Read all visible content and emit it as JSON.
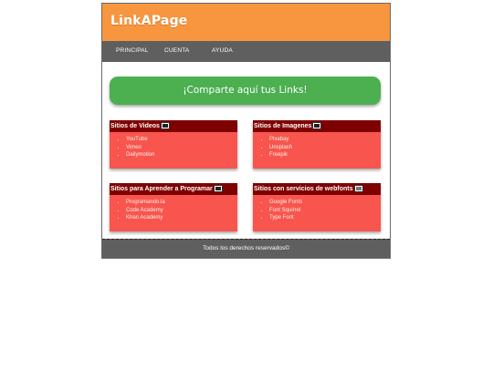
{
  "header": {
    "logo": "LinkAPage"
  },
  "nav": {
    "items": [
      "PRINCIPAL",
      "CUENTA",
      "AYUDA"
    ]
  },
  "banner": {
    "text": "¡Comparte aquí tus Links!"
  },
  "cards": [
    {
      "title": "Sitios de Videos",
      "links": [
        "YouTube",
        "Vimeo",
        "Dailymotion"
      ]
    },
    {
      "title": "Sitios de Imagenes",
      "links": [
        "Pixabay",
        "Unsplash",
        "Freepik"
      ]
    },
    {
      "title": "Sitios para Aprender a Programar",
      "links": [
        "Programando.la",
        "Code Academy",
        "Khan Academy"
      ]
    },
    {
      "title": "Sitios con servicios de webfonts",
      "links": [
        "Google Fonts",
        "Font Squirrel",
        "Type Font"
      ]
    }
  ],
  "footer": {
    "text": "Todos los derechos reservados©"
  },
  "colors": {
    "header": "#f7963f",
    "nav": "#5f5f5f",
    "banner": "#4caf50",
    "card": "#f7554d",
    "card_header": "#7f0000"
  }
}
